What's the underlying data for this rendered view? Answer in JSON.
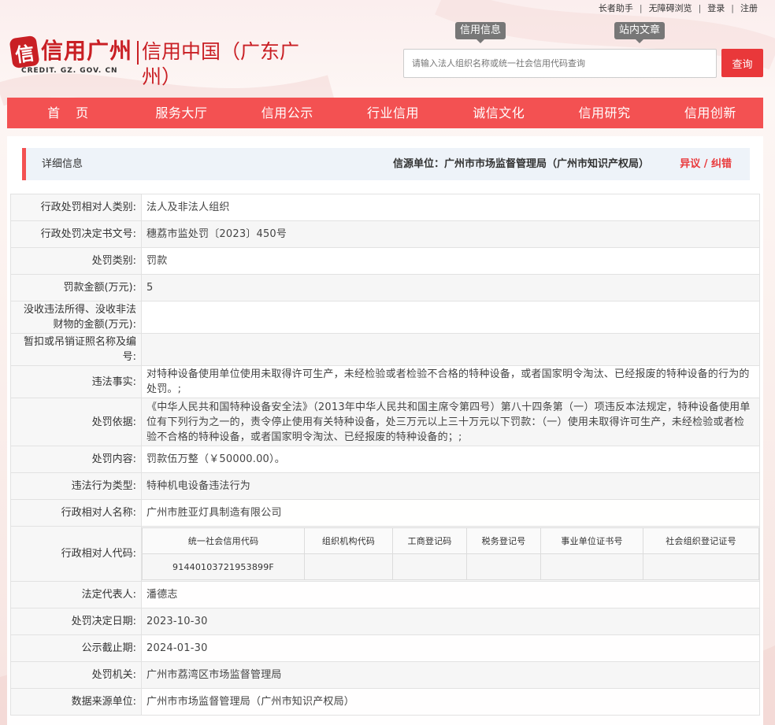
{
  "top_links": [
    "长者助手",
    "无障碍浏览",
    "登录",
    "注册"
  ],
  "header": {
    "logo_main": "信用广州",
    "logo_sub": "信用中国（广东广州）",
    "logo_url": "CREDIT. GZ. GOV. CN",
    "seal_char": "信"
  },
  "search": {
    "tab_info": "信用信息",
    "tab_site": "站内文章",
    "placeholder": "请输入法人组织名称或统一社会信用代码查询",
    "button_label": "查询"
  },
  "nav": [
    "首页",
    "服务大厅",
    "信用公示",
    "行业信用",
    "诚信文化",
    "信用研究",
    "信用创新"
  ],
  "detail": {
    "title": "详细信息",
    "source": "信源单位：广州市市场监督管理局（广州市知识产权局）",
    "objection": "异议 / 纠错"
  },
  "rows": [
    {
      "label": "行政处罚相对人类别:",
      "value": "法人及非法人组织"
    },
    {
      "label": "行政处罚决定书文号:",
      "value": "穗荔市监处罚〔2023〕450号"
    },
    {
      "label": "处罚类别:",
      "value": "罚款"
    },
    {
      "label": "罚款金额(万元):",
      "value": "5"
    },
    {
      "label": "没收违法所得、没收非法财物的金额(万元):",
      "value": ""
    },
    {
      "label": "暂扣或吊销证照名称及编号:",
      "value": ""
    },
    {
      "label": "违法事实:",
      "value": "对特种设备使用单位使用未取得许可生产，未经检验或者检验不合格的特种设备，或者国家明令淘汰、已经报废的特种设备的行为的处罚。;"
    },
    {
      "label": "处罚依据:",
      "value": "《中华人民共和国特种设备安全法》（2013年中华人民共和国主席令第四号）第八十四条第（一）项违反本法规定，特种设备使用单位有下列行为之一的，责令停止使用有关特种设备，处三万元以上三十万元以下罚款：（一）使用未取得许可生产，未经检验或者检验不合格的特种设备，或者国家明令淘汰、已经报废的特种设备的；;"
    },
    {
      "label": "处罚内容:",
      "value": "罚款伍万整（￥50000.00）。"
    },
    {
      "label": "违法行为类型:",
      "value": "特种机电设备违法行为"
    },
    {
      "label": "行政相对人名称:",
      "value": "广州市胜亚灯具制造有限公司"
    }
  ],
  "code_row": {
    "label": "行政相对人代码:",
    "headers": [
      "统一社会信用代码",
      "组织机构代码",
      "工商登记码",
      "税务登记号",
      "事业单位证书号",
      "社会组织登记证号"
    ],
    "values": [
      "91440103721953899F",
      "",
      "",
      "",
      "",
      ""
    ]
  },
  "rows2": [
    {
      "label": "法定代表人:",
      "value": "潘德志"
    },
    {
      "label": "处罚决定日期:",
      "value": "2023-10-30"
    },
    {
      "label": "公示截止期:",
      "value": "2024-01-30"
    },
    {
      "label": "处罚机关:",
      "value": "广州市荔湾区市场监督管理局"
    },
    {
      "label": "数据来源单位:",
      "value": "广州市市场监督管理局（广州市知识产权局）"
    }
  ]
}
